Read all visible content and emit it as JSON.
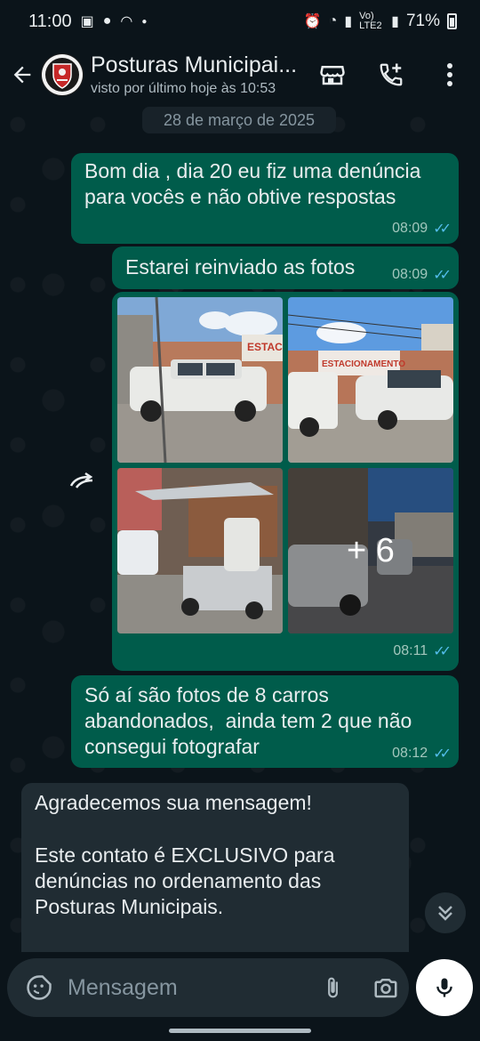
{
  "status_bar": {
    "time": "11:00",
    "battery": "71%",
    "network": "Vo) LTE2"
  },
  "header": {
    "contact_name": "Posturas Municipai...",
    "last_seen": "visto por último hoje às 10:53",
    "icons": [
      "back-arrow-icon",
      "store-icon",
      "add-call-icon",
      "more-vert-icon"
    ]
  },
  "chat": {
    "date_chip": "28 de março de 2025",
    "messages": [
      {
        "direction": "out",
        "text": "Bom dia , dia 20 eu fiz uma denúncia para vocês e não obtive respostas",
        "line1": "Bom dia , dia 20 eu fiz uma denúncia",
        "line2": "para vocês e não obtive respostas",
        "time": "08:09"
      },
      {
        "direction": "out",
        "text": "Estarei reinviado as fotos",
        "time": "08:09"
      },
      {
        "direction": "out",
        "type": "photo-album",
        "more_count": "+ 6",
        "time": "08:11"
      },
      {
        "direction": "out",
        "line1": "Só aí são fotos de 8 carros",
        "line2": "abandonados,  ainda tem 2 que não",
        "line3": "consegui fotografar",
        "time": "08:12"
      },
      {
        "direction": "in",
        "line1": "Agradecemos sua mensagem!",
        "line2": "Este contato é EXCLUSIVO para",
        "line3": "denúncias no ordenamento das",
        "line4": "Posturas Municipais."
      }
    ]
  },
  "composer": {
    "placeholder": "Mensagem"
  },
  "colors": {
    "background": "#0b141a",
    "outgoing_bubble": "#005c4b",
    "incoming_bubble": "#202c33",
    "read_ticks": "#53bdeb"
  }
}
